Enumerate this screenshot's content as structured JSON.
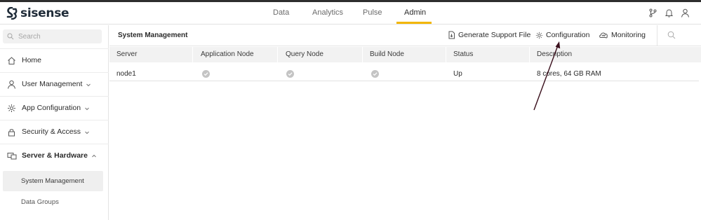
{
  "brand": {
    "name": "sisense"
  },
  "nav": {
    "items": [
      {
        "label": "Data"
      },
      {
        "label": "Analytics"
      },
      {
        "label": "Pulse"
      },
      {
        "label": "Admin"
      }
    ],
    "active": "Admin",
    "accent_color": "#f2b600"
  },
  "top_icons": [
    "git-branch-icon",
    "bell-icon",
    "user-icon"
  ],
  "sidebar": {
    "search": {
      "placeholder": "Search",
      "value": ""
    },
    "items": [
      {
        "label": "Home",
        "icon": "home-icon",
        "chevron": ""
      },
      {
        "label": "User Management",
        "icon": "user-icon",
        "chevron": "down"
      },
      {
        "label": "App Configuration",
        "icon": "gear-icon",
        "chevron": "down"
      },
      {
        "label": "Security & Access",
        "icon": "lock-icon",
        "chevron": "down"
      },
      {
        "label": "Server & Hardware",
        "icon": "server-icon",
        "chevron": "up"
      }
    ],
    "sub_items": [
      {
        "label": "System Management",
        "active": true
      },
      {
        "label": "Data Groups",
        "active": false
      }
    ]
  },
  "main": {
    "title": "System Management",
    "toolbar": {
      "generate_support_file": "Generate Support File",
      "configuration": "Configuration",
      "monitoring": "Monitoring"
    },
    "table": {
      "columns": [
        "Server",
        "Application Node",
        "Query Node",
        "Build Node",
        "Status",
        "Description"
      ],
      "rows": [
        {
          "server": "node1",
          "application_node": true,
          "query_node": true,
          "build_node": true,
          "status": "Up",
          "description": "8 cores, 64 GB RAM"
        }
      ]
    }
  },
  "annotation_color": "#3a0f1c"
}
